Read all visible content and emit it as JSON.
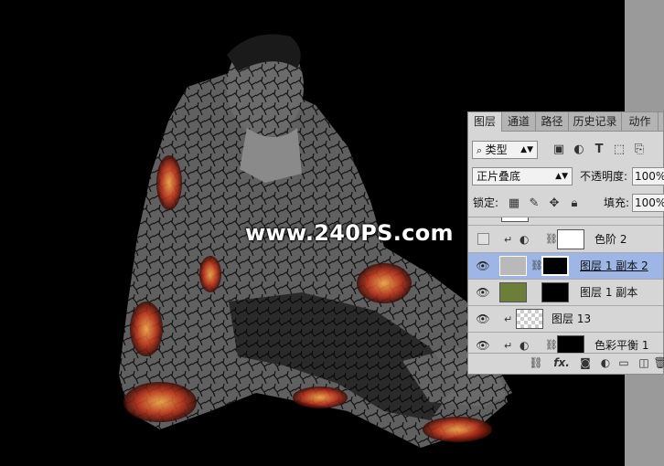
{
  "watermark": "www.240PS.com",
  "panel": {
    "tabs": [
      "图层",
      "通道",
      "路径",
      "历史记录",
      "动作"
    ],
    "filter_kind": "类型",
    "blend_mode": "正片叠底",
    "opacity_label": "不透明度:",
    "opacity_value": "100%",
    "lock_label": "锁定:",
    "fill_label": "填充:",
    "fill_value": "100%",
    "layers": [
      {
        "name": "色阶 2",
        "visible": false,
        "selected": false
      },
      {
        "name": "图层 1 副本 2",
        "visible": true,
        "selected": true
      },
      {
        "name": "图层 1 副本",
        "visible": true,
        "selected": false
      },
      {
        "name": "图层 13",
        "visible": true,
        "selected": false
      },
      {
        "name": "色彩平衡 1",
        "visible": true,
        "selected": false
      }
    ],
    "bottom_fx": "fx."
  },
  "colors": {
    "selected_row": "#9db6e6",
    "panel_bg": "#d6d6d6",
    "canvas_bg": "#000000"
  }
}
